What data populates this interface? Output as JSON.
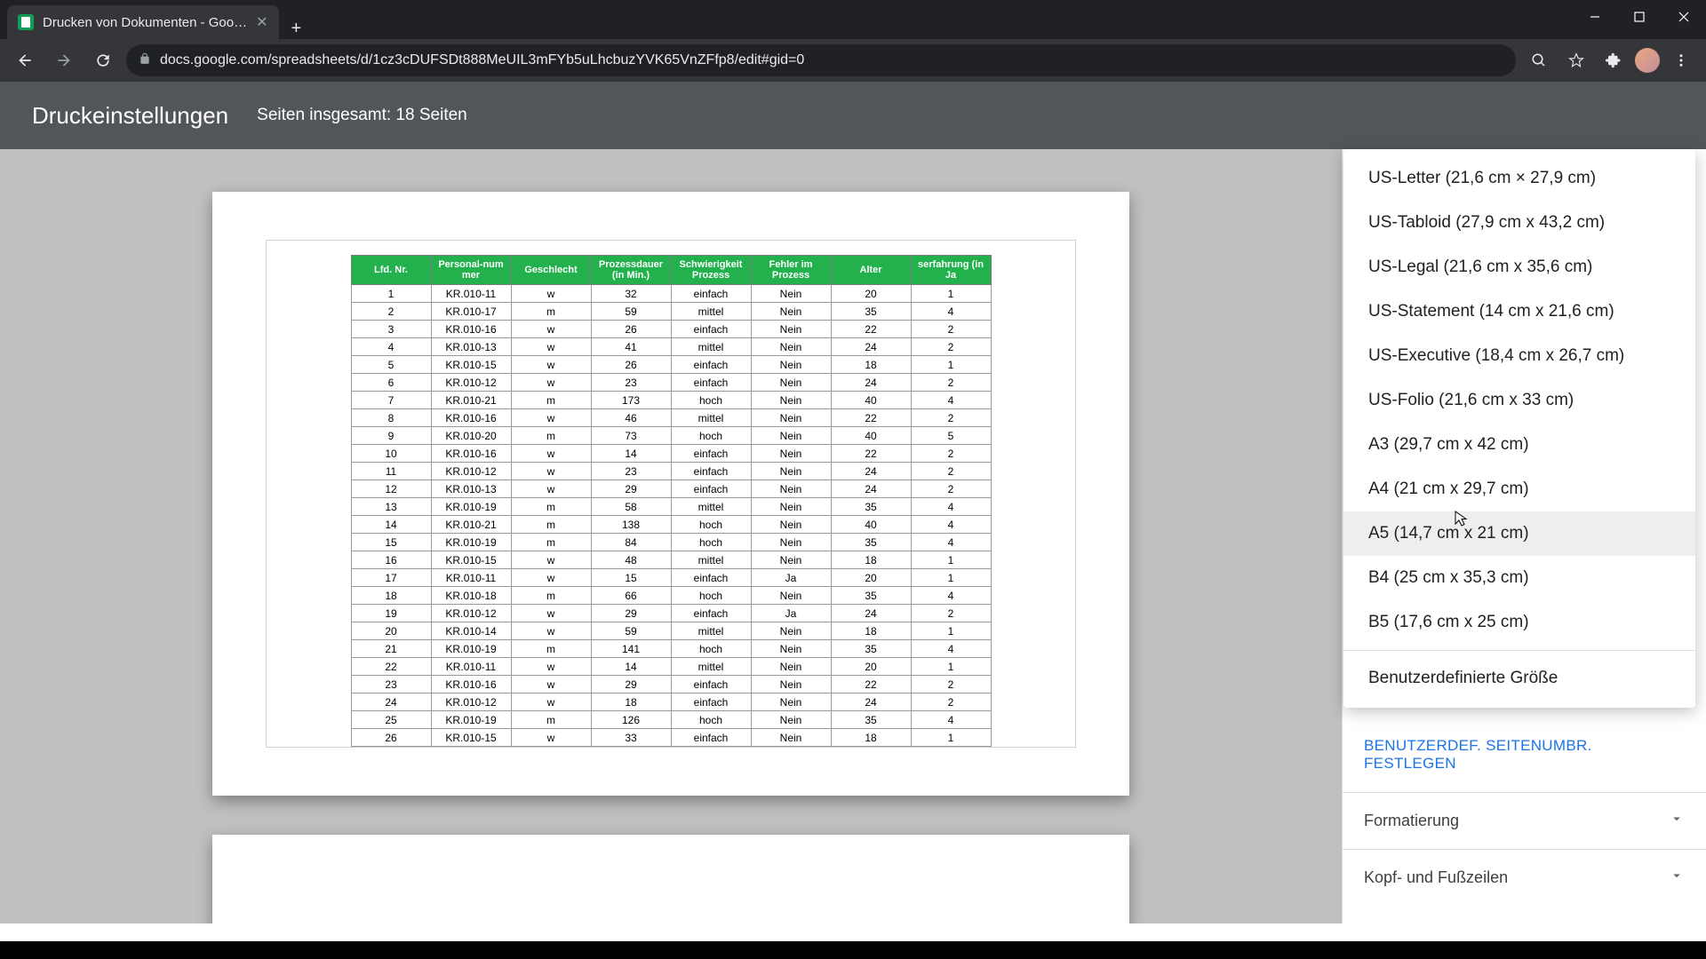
{
  "browser": {
    "tab_title": "Drucken von Dokumenten - Goo…",
    "url": "docs.google.com/spreadsheets/d/1cz3cDUFSDt888MeUIL3mFYb5uLhcbuzYVK65VnZFfp8/edit#gid=0"
  },
  "header": {
    "title": "Druckeinstellungen",
    "subtitle": "Seiten insgesamt: 18 Seiten"
  },
  "table": {
    "headers": [
      "Lfd. Nr.",
      "Personal-num mer",
      "Geschlecht",
      "Prozessdauer (in Min.)",
      "Schwierigkeit Prozess",
      "Fehler im Prozess",
      "Alter",
      "serfahrung (in Ja"
    ],
    "rows": [
      [
        "1",
        "KR.010-11",
        "w",
        "32",
        "einfach",
        "Nein",
        "20",
        "1"
      ],
      [
        "2",
        "KR.010-17",
        "m",
        "59",
        "mittel",
        "Nein",
        "35",
        "4"
      ],
      [
        "3",
        "KR.010-16",
        "w",
        "26",
        "einfach",
        "Nein",
        "22",
        "2"
      ],
      [
        "4",
        "KR.010-13",
        "w",
        "41",
        "mittel",
        "Nein",
        "24",
        "2"
      ],
      [
        "5",
        "KR.010-15",
        "w",
        "26",
        "einfach",
        "Nein",
        "18",
        "1"
      ],
      [
        "6",
        "KR.010-12",
        "w",
        "23",
        "einfach",
        "Nein",
        "24",
        "2"
      ],
      [
        "7",
        "KR.010-21",
        "m",
        "173",
        "hoch",
        "Nein",
        "40",
        "4"
      ],
      [
        "8",
        "KR.010-16",
        "w",
        "46",
        "mittel",
        "Nein",
        "22",
        "2"
      ],
      [
        "9",
        "KR.010-20",
        "m",
        "73",
        "hoch",
        "Nein",
        "40",
        "5"
      ],
      [
        "10",
        "KR.010-16",
        "w",
        "14",
        "einfach",
        "Nein",
        "22",
        "2"
      ],
      [
        "11",
        "KR.010-12",
        "w",
        "23",
        "einfach",
        "Nein",
        "24",
        "2"
      ],
      [
        "12",
        "KR.010-13",
        "w",
        "29",
        "einfach",
        "Nein",
        "24",
        "2"
      ],
      [
        "13",
        "KR.010-19",
        "m",
        "58",
        "mittel",
        "Nein",
        "35",
        "4"
      ],
      [
        "14",
        "KR.010-21",
        "m",
        "138",
        "hoch",
        "Nein",
        "40",
        "4"
      ],
      [
        "15",
        "KR.010-19",
        "m",
        "84",
        "hoch",
        "Nein",
        "35",
        "4"
      ],
      [
        "16",
        "KR.010-15",
        "w",
        "48",
        "mittel",
        "Nein",
        "18",
        "1"
      ],
      [
        "17",
        "KR.010-11",
        "w",
        "15",
        "einfach",
        "Ja",
        "20",
        "1"
      ],
      [
        "18",
        "KR.010-18",
        "m",
        "66",
        "hoch",
        "Nein",
        "35",
        "4"
      ],
      [
        "19",
        "KR.010-12",
        "w",
        "29",
        "einfach",
        "Ja",
        "24",
        "2"
      ],
      [
        "20",
        "KR.010-14",
        "w",
        "59",
        "mittel",
        "Nein",
        "18",
        "1"
      ],
      [
        "21",
        "KR.010-19",
        "m",
        "141",
        "hoch",
        "Nein",
        "35",
        "4"
      ],
      [
        "22",
        "KR.010-11",
        "w",
        "14",
        "mittel",
        "Nein",
        "20",
        "1"
      ],
      [
        "23",
        "KR.010-16",
        "w",
        "29",
        "einfach",
        "Nein",
        "22",
        "2"
      ],
      [
        "24",
        "KR.010-12",
        "w",
        "18",
        "einfach",
        "Nein",
        "24",
        "2"
      ],
      [
        "25",
        "KR.010-19",
        "m",
        "126",
        "hoch",
        "Nein",
        "35",
        "4"
      ],
      [
        "26",
        "KR.010-15",
        "w",
        "33",
        "einfach",
        "Nein",
        "18",
        "1"
      ]
    ]
  },
  "paper_sizes": [
    {
      "label": "US-Letter (21,6 cm × 27,9 cm)"
    },
    {
      "label": "US-Tabloid (27,9 cm x 43,2 cm)"
    },
    {
      "label": "US-Legal (21,6 cm x 35,6 cm)"
    },
    {
      "label": "US-Statement (14 cm x 21,6 cm)"
    },
    {
      "label": "US-Executive (18,4 cm x 26,7 cm)"
    },
    {
      "label": "US-Folio (21,6 cm x 33 cm)"
    },
    {
      "label": "A3 (29,7 cm x 42 cm)"
    },
    {
      "label": "A4 (21 cm x 29,7 cm)"
    },
    {
      "label": "A5 (14,7 cm x 21 cm)",
      "hovered": true
    },
    {
      "label": "B4 (25 cm x 35,3 cm)"
    },
    {
      "label": "B5 (17,6 cm x 25 cm)"
    }
  ],
  "custom_size_label": "Benutzerdefinierte Größe",
  "sidebar": {
    "custom_breaks": "BENUTZERDEF. SEITENUMBR. FESTLEGEN",
    "formatting": "Formatierung",
    "header_footer": "Kopf- und Fußzeilen"
  }
}
